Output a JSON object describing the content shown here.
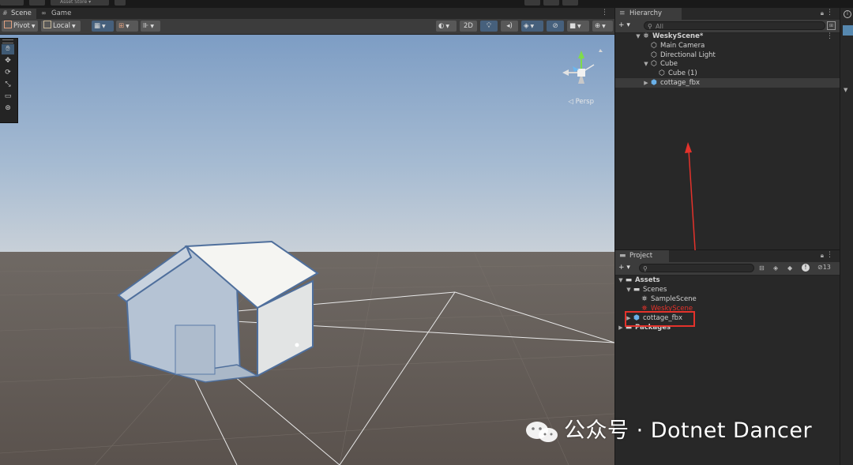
{
  "topbar": {
    "asset_store_label": "Asset Store ▾"
  },
  "scene_panel": {
    "tabs": [
      {
        "label": "Scene",
        "icon": "scene-grid-icon"
      },
      {
        "label": "Game",
        "icon": "gamepad-icon"
      }
    ],
    "toolbar": {
      "pivot_label": "Pivot",
      "local_label": "Local",
      "mode_2d_label": "2D"
    },
    "viewport": {
      "projection_label": "◁ Persp"
    }
  },
  "hierarchy": {
    "title": "Hierarchy",
    "search_placeholder": "All",
    "add_label": "+ ▾",
    "items": [
      {
        "label": "WeskyScene*",
        "icon": "unity-scene-icon",
        "depth": 0,
        "expanded": true
      },
      {
        "label": "Main Camera",
        "icon": "gameobject-cube-icon",
        "depth": 1
      },
      {
        "label": "Directional Light",
        "icon": "gameobject-cube-icon",
        "depth": 1
      },
      {
        "label": "Cube",
        "icon": "gameobject-cube-icon",
        "depth": 1,
        "expanded": true
      },
      {
        "label": "Cube (1)",
        "icon": "gameobject-cube-icon",
        "depth": 2
      },
      {
        "label": "cottage_fbx",
        "icon": "prefab-cube-icon",
        "depth": 1,
        "collapsed": true
      }
    ]
  },
  "project": {
    "title": "Project",
    "add_label": "+ ▾",
    "hidden_count": "13",
    "items": [
      {
        "label": "Assets",
        "icon": "folder-open-icon",
        "depth": 0,
        "expanded": true
      },
      {
        "label": "Scenes",
        "icon": "folder-open-icon",
        "depth": 1,
        "expanded": true
      },
      {
        "label": "SampleScene",
        "icon": "unity-scene-icon",
        "depth": 2
      },
      {
        "label": "WeskyScene",
        "icon": "unity-scene-icon",
        "depth": 2,
        "color": "#e4322b"
      },
      {
        "label": "cottage_fbx",
        "icon": "prefab-cube-icon",
        "depth": 1,
        "collapsed": true
      },
      {
        "label": "Packages",
        "icon": "folder-icon",
        "depth": 0,
        "collapsed": true
      }
    ]
  },
  "watermark": {
    "text": "公众号 · Dotnet Dancer"
  },
  "colors": {
    "annotation_red": "#e4322b",
    "selection_blue": "#46607c",
    "panel_bg": "#282828",
    "toolbar_bg": "#3c3c3c"
  }
}
